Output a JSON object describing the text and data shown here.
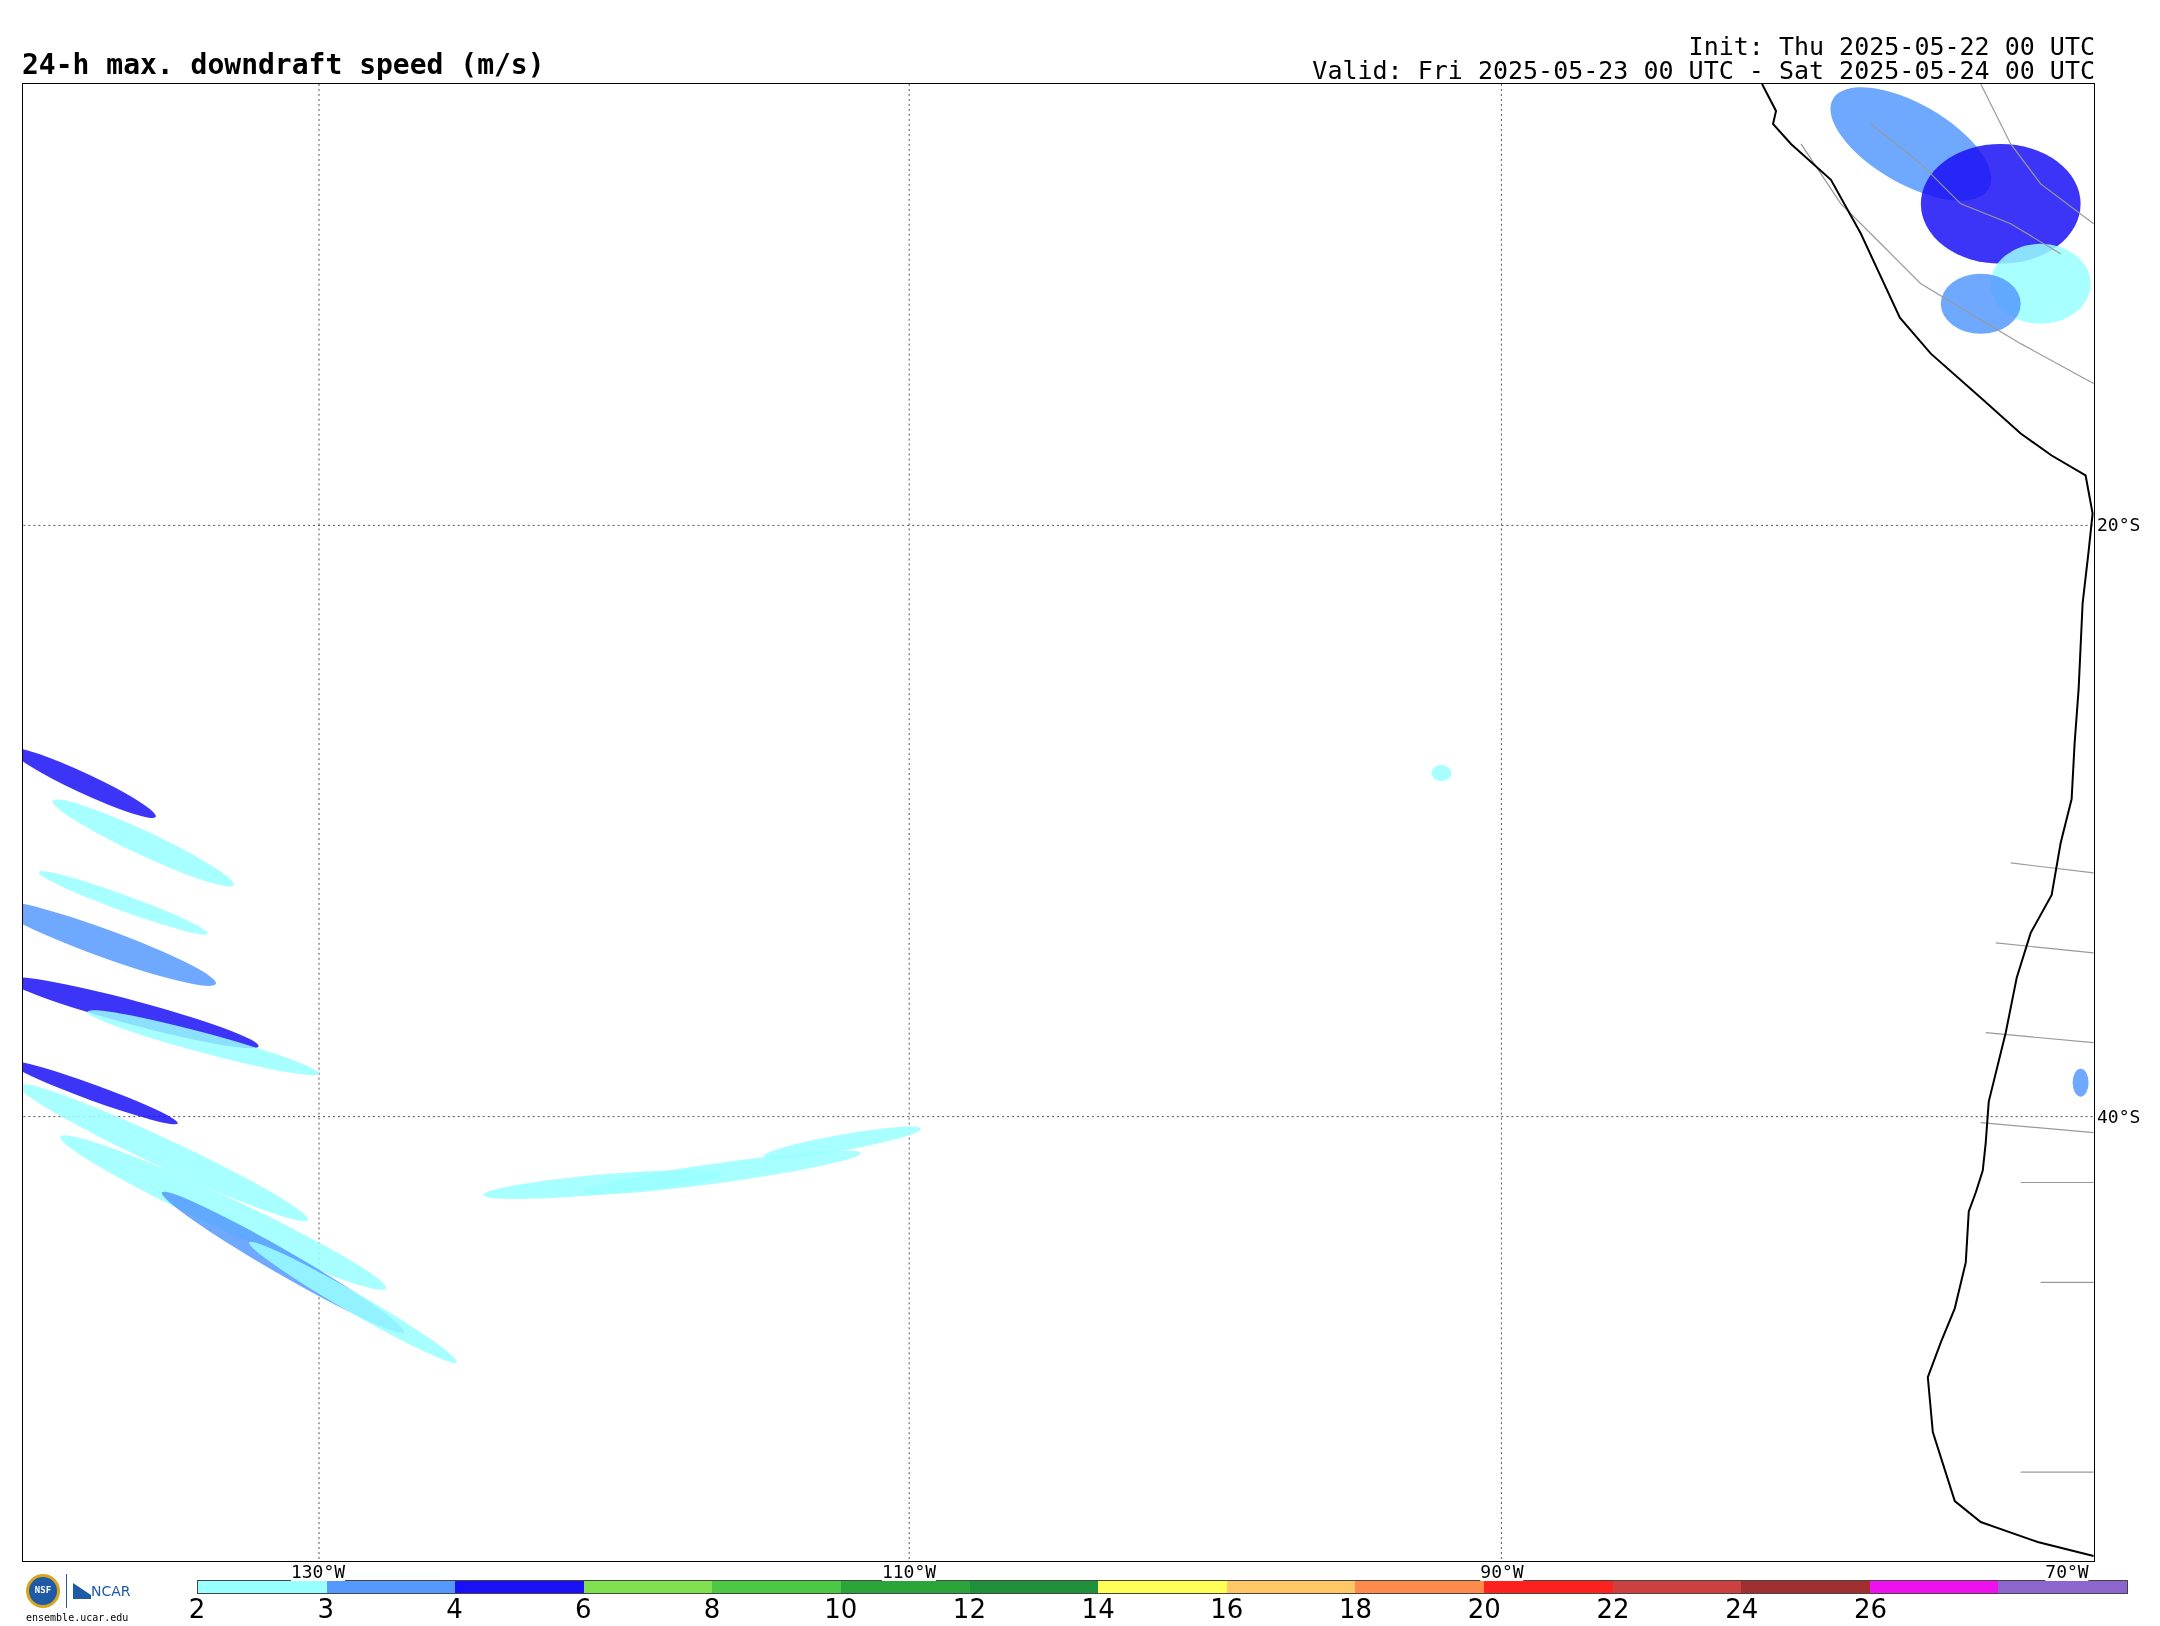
{
  "title": "24-h max. downdraft speed (m/s)",
  "init": "Init: Thu 2025-05-22 00 UTC",
  "valid": "Valid: Fri 2025-05-23 00 UTC - Sat 2025-05-24 00 UTC",
  "map": {
    "lat_labels": [
      "20°S",
      "40°S"
    ],
    "lon_labels": [
      "130°W",
      "110°W",
      "90°W",
      "70°W"
    ]
  },
  "logo": {
    "nsf": "NSF",
    "ncar": "NCAR",
    "url": "ensemble.ucar.edu"
  },
  "colorbar": [
    {
      "color": "#99ffff",
      "label": "2"
    },
    {
      "color": "#5599ff",
      "label": "3"
    },
    {
      "color": "#1a10f5",
      "label": "4"
    },
    {
      "color": "#80e050",
      "label": "6"
    },
    {
      "color": "#4cc845",
      "label": "8"
    },
    {
      "color": "#2da43a",
      "label": "10"
    },
    {
      "color": "#1f8f3a",
      "label": "12"
    },
    {
      "color": "#ffff55",
      "label": "14"
    },
    {
      "color": "#ffc766",
      "label": "16"
    },
    {
      "color": "#ff8a4c",
      "label": "18"
    },
    {
      "color": "#ff2020",
      "label": "20"
    },
    {
      "color": "#cc4040",
      "label": "22"
    },
    {
      "color": "#a03030",
      "label": "24"
    },
    {
      "color": "#ee10ee",
      "label": "26"
    },
    {
      "color": "#8c66cc"
    }
  ]
}
